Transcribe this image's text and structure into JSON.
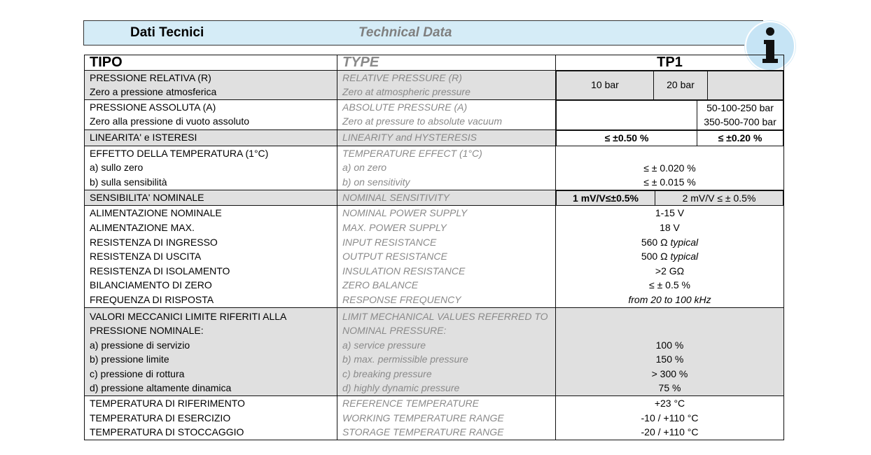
{
  "header": {
    "title_it": "Dati Tecnici",
    "title_en": "Technical Data"
  },
  "icons": {
    "info": "info-icon"
  },
  "table": {
    "head": {
      "it": "TIPO",
      "en": "TYPE",
      "model": "TP1"
    },
    "relative_pressure": {
      "it": [
        "PRESSIONE RELATIVA (R)",
        "Zero a pressione atmosferica"
      ],
      "en": [
        "RELATIVE PRESSURE (R)",
        "Zero at atmospheric pressure"
      ],
      "v1": "10 bar",
      "v2": "20  bar"
    },
    "absolute_pressure": {
      "it": [
        "PRESSIONE ASSOLUTA (A)",
        "Zero alla pressione di vuoto assoluto"
      ],
      "en": [
        "ABSOLUTE PRESSURE (A)",
        "Zero at pressure to absolute vacuum"
      ],
      "v1": "50-100-250 bar",
      "v2": "350-500-700 bar"
    },
    "linearity": {
      "it": "LINEARITA' e ISTERESI",
      "en": "LINEARITY and HYSTERESIS",
      "v1": "≤ ±0.50 %",
      "v2": "≤ ±0.20 %"
    },
    "temp_effect": {
      "it": [
        "EFFETTO DELLA TEMPERATURA (1°C)",
        "a) sullo zero",
        "b) sulla sensibilità"
      ],
      "en": [
        "TEMPERATURE EFFECT (1°C)",
        "a) on zero",
        "b) on sensitivity"
      ],
      "v1": "≤ ± 0.020 %",
      "v2": "≤ ± 0.015 %"
    },
    "sensitivity": {
      "it": "SENSIBILITA' NOMINALE",
      "en": "NOMINAL SENSITIVITY",
      "v1": "1 mV/V≤±0.5%",
      "v2": "2 mV/V ≤ ± 0.5%"
    },
    "electrical": {
      "it": [
        "ALIMENTAZIONE NOMINALE",
        "ALIMENTAZIONE MAX.",
        "RESISTENZA DI INGRESSO",
        "RESISTENZA DI USCITA",
        "RESISTENZA DI ISOLAMENTO",
        "BILANCIAMENTO DI ZERO",
        "FREQUENZA DI RISPOSTA"
      ],
      "en": [
        "NOMINAL POWER SUPPLY",
        "MAX. POWER SUPPLY",
        "INPUT RESISTANCE",
        "OUTPUT RESISTANCE",
        "INSULATION RESISTANCE",
        "ZERO BALANCE",
        "RESPONSE FREQUENCY"
      ],
      "v": [
        "1-15 V",
        "18 V",
        "560 Ω",
        "500 Ω",
        ">2 GΩ",
        "≤ ± 0.5 %",
        "from 20 to 100 kHz"
      ],
      "typical": "typical"
    },
    "mechanical": {
      "it": [
        "VALORI MECCANICI LIMITE RIFERITI ALLA",
        "PRESSIONE NOMINALE:",
        "a) pressione di servizio",
        "b) pressione limite",
        "c) pressione di rottura",
        "d) pressione altamente dinamica"
      ],
      "en": [
        "LIMIT MECHANICAL VALUES REFERRED TO",
        "NOMINAL PRESSURE:",
        "a) service pressure",
        "b) max. permissible pressure",
        "c) breaking pressure",
        "d) highly dynamic pressure"
      ],
      "v": [
        "100 %",
        "150 %",
        "> 300 %",
        "75 %"
      ]
    },
    "temperature": {
      "it": [
        "TEMPERATURA DI RIFERIMENTO",
        "TEMPERATURA DI ESERCIZIO",
        "TEMPERATURA DI STOCCAGGIO"
      ],
      "en": [
        "REFERENCE TEMPERATURE",
        "WORKING TEMPERATURE RANGE",
        "STORAGE TEMPERATURE RANGE"
      ],
      "v": [
        "+23 °C",
        "-10 / +110 °C",
        "-20 / +110 °C"
      ]
    }
  }
}
